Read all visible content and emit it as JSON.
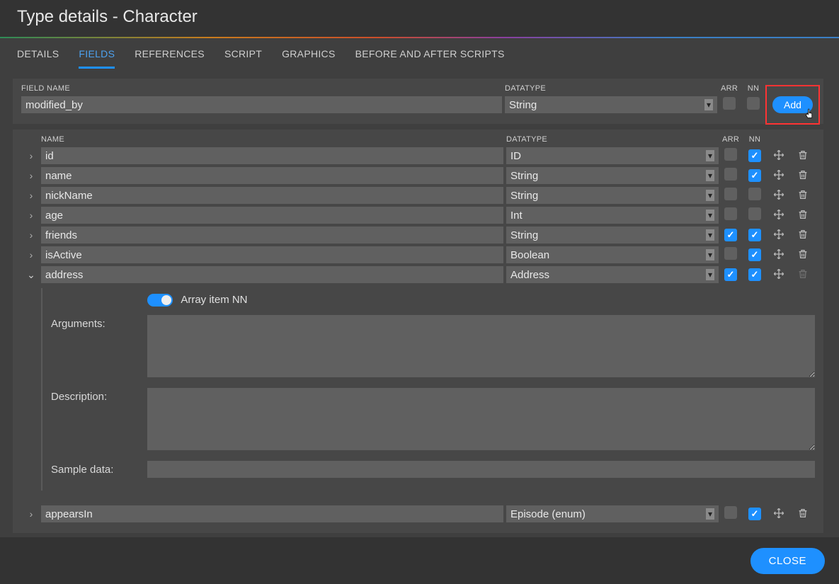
{
  "title": "Type details - Character",
  "tabs": [
    "DETAILS",
    "FIELDS",
    "REFERENCES",
    "SCRIPT",
    "GRAPHICS",
    "BEFORE AND AFTER SCRIPTS"
  ],
  "active_tab": 1,
  "add_panel": {
    "headers": {
      "name": "FIELD NAME",
      "datatype": "DATATYPE",
      "arr": "ARR",
      "nn": "NN"
    },
    "name_value": "modified_by",
    "datatype_value": "String",
    "arr": false,
    "nn": false,
    "add_label": "Add"
  },
  "grid": {
    "headers": {
      "name": "NAME",
      "datatype": "DATATYPE",
      "arr": "ARR",
      "nn": "NN"
    },
    "rows": [
      {
        "expanded": false,
        "name": "id",
        "datatype": "ID",
        "arr": false,
        "nn": true,
        "trash_enabled": true
      },
      {
        "expanded": false,
        "name": "name",
        "datatype": "String",
        "arr": false,
        "nn": true,
        "trash_enabled": true
      },
      {
        "expanded": false,
        "name": "nickName",
        "datatype": "String",
        "arr": false,
        "nn": false,
        "trash_enabled": true
      },
      {
        "expanded": false,
        "name": "age",
        "datatype": "Int",
        "arr": false,
        "nn": false,
        "trash_enabled": true
      },
      {
        "expanded": false,
        "name": "friends",
        "datatype": "String",
        "arr": true,
        "nn": true,
        "trash_enabled": true
      },
      {
        "expanded": false,
        "name": "isActive",
        "datatype": "Boolean",
        "arr": false,
        "nn": true,
        "trash_enabled": true
      },
      {
        "expanded": true,
        "name": "address",
        "datatype": "Address",
        "arr": true,
        "nn": true,
        "trash_enabled": false
      }
    ],
    "expanded_detail": {
      "array_item_nn_label": "Array item NN",
      "array_item_nn": true,
      "arguments_label": "Arguments:",
      "arguments_value": "",
      "description_label": "Description:",
      "description_value": "",
      "sample_label": "Sample data:",
      "sample_value": ""
    },
    "extra_rows": [
      {
        "expanded": false,
        "name": "appearsIn",
        "datatype": "Episode (enum)",
        "arr": false,
        "nn": true,
        "trash_enabled": true
      }
    ]
  },
  "footer": {
    "close_label": "CLOSE"
  }
}
